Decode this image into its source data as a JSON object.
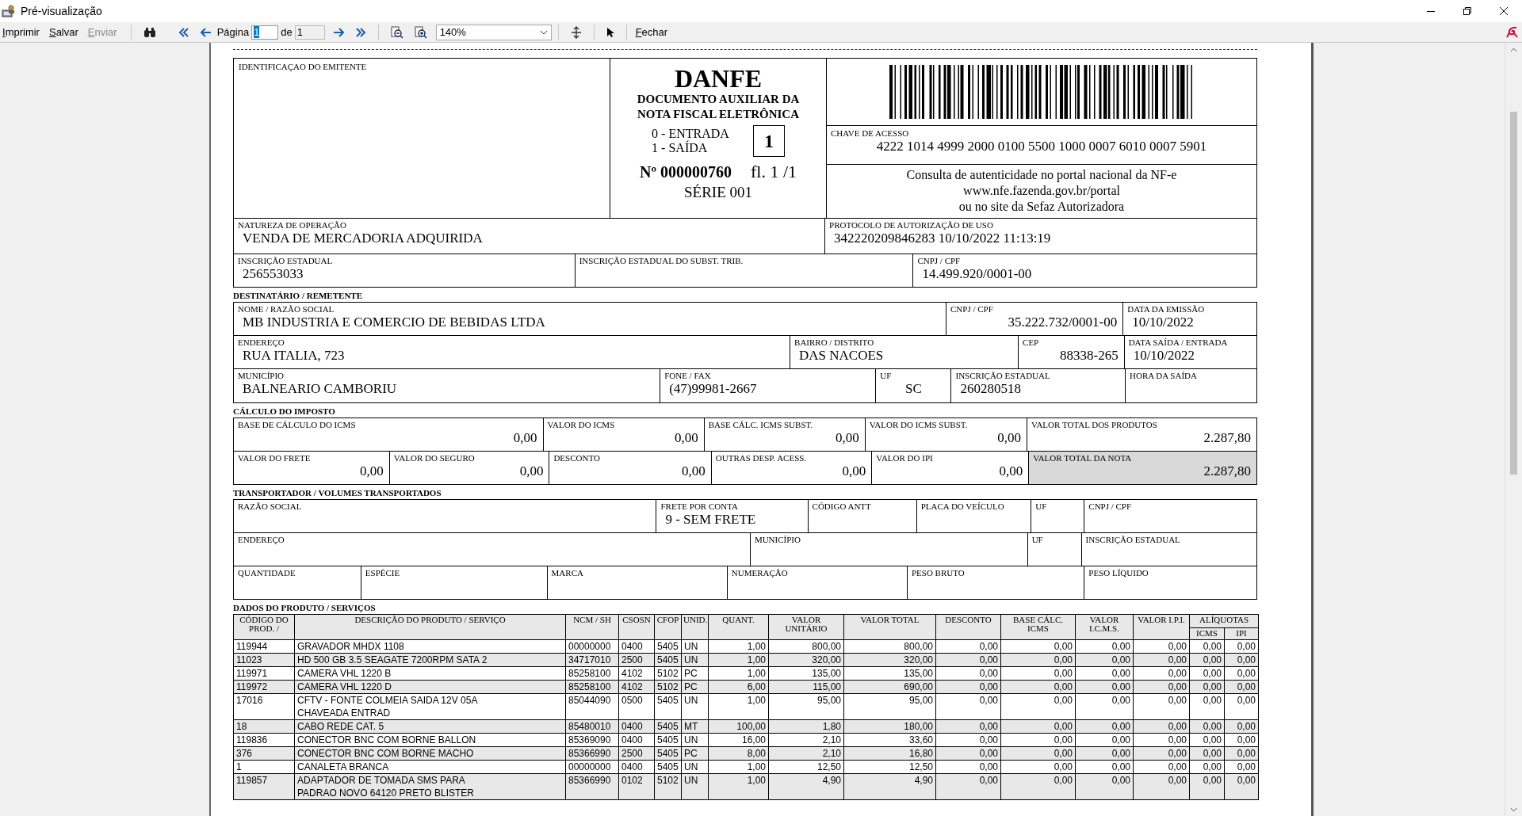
{
  "window": {
    "title": "Pré-visualização"
  },
  "toolbar": {
    "actions": [
      {
        "label": "Imprimir",
        "disabled": false
      },
      {
        "label": "Salvar",
        "disabled": false
      },
      {
        "label": "Enviar",
        "disabled": true
      }
    ],
    "page_label": "Página",
    "page_value": "1",
    "of_label": "de",
    "page_count": "1",
    "zoom": "140%",
    "close": "Fechar"
  },
  "document": {
    "header": {
      "emitter_label": "IDENTIFICAÇAO DO EMITENTE",
      "title": "DANFE",
      "subtitle": [
        "DOCUMENTO AUXILIAR DA",
        "NOTA FISCAL ELETRÔNICA"
      ],
      "operations": [
        "0 - ENTRADA",
        "1 - SAÍDA"
      ],
      "operation_type": "1",
      "number": "Nº 000000760",
      "sheet": "fl. 1 /1",
      "series": "SÉRIE 001",
      "access_key_label": "CHAVE DE ACESSO",
      "access_key": "4222 1014 4999 2000 0100 5500 1000 0007 6010 0007 5901",
      "consult": [
        "Consulta de autenticidade no portal nacional da NF-e",
        "www.nfe.fazenda.gov.br/portal",
        "ou no site da Sefaz Autorizadora"
      ]
    },
    "blocks": [
      {
        "lines": [
          {
            "fields": [
              {
                "label": "NATUREZA DE OPERAÇÃO",
                "value": "VENDA DE MERCADORIA ADQUIRIDA"
              },
              {
                "label": "PROTOCOLO DE AUTORIZAÇÃO DE USO",
                "value": "342220209846283 10/10/2022 11:13:19"
              }
            ]
          },
          {
            "fields": [
              {
                "label": "INSCRIÇÃO ESTADUAL",
                "value": "256553033"
              },
              {
                "label": "INSCRIÇÃO ESTADUAL DO SUBST. TRIB."
              },
              {
                "label": "CNPJ / CPF",
                "value": "14.499.920/0001-00"
              }
            ]
          }
        ]
      },
      {
        "heading": "DESTINATÁRIO / REMETENTE",
        "lines": [
          {
            "fields": [
              {
                "label": "NOME / RAZÃO SOCIAL",
                "value": "MB INDUSTRIA E COMERCIO DE BEBIDAS LTDA"
              },
              {
                "label": "CNPJ / CPF",
                "value": "35.222.732/0001-00"
              },
              {
                "label": "DATA DA EMISSÃO",
                "value": "10/10/2022"
              }
            ]
          },
          {
            "fields": [
              {
                "label": "ENDEREÇO",
                "value": "RUA ITALIA, 723"
              },
              {
                "label": "BAIRRO / DISTRITO",
                "value": "DAS NACOES"
              },
              {
                "label": "CEP",
                "value": "88338-265"
              },
              {
                "label": "DATA SAÍDA / ENTRADA",
                "value": "10/10/2022"
              }
            ]
          },
          {
            "fields": [
              {
                "label": "MUNICÍPIO",
                "value": "BALNEARIO CAMBORIU"
              },
              {
                "label": "FONE / FAX",
                "value": "(47)99981-2667"
              },
              {
                "label": "UF",
                "value": "SC"
              },
              {
                "label": "INSCRIÇÃO ESTADUAL",
                "value": "260280518"
              },
              {
                "label": "HORA DA SAÍDA"
              }
            ]
          }
        ]
      },
      {
        "heading": "CÁLCULO DO IMPOSTO",
        "lines": [
          {
            "fields": [
              {
                "label": "BASE DE CÁLCULO DO ICMS",
                "value": "0,00",
                "highlighted": false
              },
              {
                "label": "VALOR DO ICMS",
                "value": "0,00",
                "highlighted": false
              },
              {
                "label": "BASE CÁLC. ICMS SUBST.",
                "value": "0,00",
                "highlighted": false
              },
              {
                "label": "VALOR DO ICMS SUBST.",
                "value": "0,00",
                "highlighted": false
              },
              {
                "label": "VALOR TOTAL DOS PRODUTOS",
                "value": "2.287,80",
                "highlighted": false
              }
            ]
          },
          {
            "fields": [
              {
                "label": "VALOR DO FRETE",
                "value": "0,00",
                "highlighted": false
              },
              {
                "label": "VALOR DO SEGURO",
                "value": "0,00",
                "highlighted": false
              },
              {
                "label": "DESCONTO",
                "value": "0,00",
                "highlighted": false
              },
              {
                "label": "OUTRAS DESP. ACESS.",
                "value": "0,00",
                "highlighted": false
              },
              {
                "label": "VALOR DO IPI",
                "value": "0,00",
                "highlighted": false
              },
              {
                "label": "VALOR TOTAL DA NOTA",
                "value": "2.287,80",
                "highlighted": true
              }
            ]
          }
        ]
      },
      {
        "heading": "TRANSPORTADOR / VOLUMES TRANSPORTADOS",
        "lines": [
          {
            "fields": [
              {
                "label": "RAZÃO SOCIAL"
              },
              {
                "label": "FRETE POR CONTA",
                "value": "9 - SEM FRETE"
              },
              {
                "label": "CÓDIGO ANTT"
              },
              {
                "label": "PLACA DO VEÍCULO"
              },
              {
                "label": "UF"
              },
              {
                "label": "CNPJ / CPF"
              }
            ]
          },
          {
            "fields": [
              {
                "label": "ENDEREÇO"
              },
              {
                "label": "MUNICÍPIO"
              },
              {
                "label": "UF"
              },
              {
                "label": "INSCRIÇÃO ESTADUAL"
              }
            ]
          },
          {
            "fields": [
              {
                "label": "QUANTIDADE"
              },
              {
                "label": "ESPÉCIE"
              },
              {
                "label": "MARCA"
              },
              {
                "label": "NUMERAÇÃO"
              },
              {
                "label": "PESO BRUTO"
              },
              {
                "label": "PESO LÍQUIDO"
              }
            ]
          }
        ]
      }
    ],
    "products": {
      "heading": "DADOS DO PRODUTO / SERVIÇOS",
      "columns": [
        "CÓDIGO DO PROD. /",
        "DESCRIÇÃO DO PRODUTO / SERVIÇO",
        "NCM / SH",
        "CSOSN",
        "CFOP",
        "UNID.",
        "QUANT.",
        "VALOR UNITÁRIO",
        "VALOR TOTAL",
        "DESCONTO",
        "BASE CÁLC. ICMS",
        "VALOR I.C.M.S.",
        "VALOR I.P.I.",
        "ICMS",
        "IPI"
      ],
      "group_header": "ALÍQUOTAS",
      "rows": [
        [
          "119944",
          "GRAVADOR MHDX 1108",
          "00000000",
          "0400",
          "5405",
          "UN",
          "1,00",
          "800,00",
          "800,00",
          "0,00",
          "0,00",
          "0,00",
          "0,00",
          "0,00",
          "0,00"
        ],
        [
          "11023",
          "HD 500 GB 3.5 SEAGATE 7200RPM SATA 2",
          "34717010",
          "2500",
          "5405",
          "UN",
          "1,00",
          "320,00",
          "320,00",
          "0,00",
          "0,00",
          "0,00",
          "0,00",
          "0,00",
          "0,00"
        ],
        [
          "119971",
          "CAMERA VHL 1220 B",
          "85258100",
          "4102",
          "5102",
          "PC",
          "1,00",
          "135,00",
          "135,00",
          "0,00",
          "0,00",
          "0,00",
          "0,00",
          "0,00",
          "0,00"
        ],
        [
          "119972",
          "CAMERA VHL 1220 D",
          "85258100",
          "4102",
          "5102",
          "PC",
          "6,00",
          "115,00",
          "690,00",
          "0,00",
          "0,00",
          "0,00",
          "0,00",
          "0,00",
          "0,00"
        ],
        [
          "17016",
          "CFTV - FONTE COLMEIA SAIDA 12V 05A\nCHAVEADA ENTRAD",
          "85044090",
          "0500",
          "5405",
          "UN",
          "1,00",
          "95,00",
          "95,00",
          "0,00",
          "0,00",
          "0,00",
          "0,00",
          "0,00",
          "0,00"
        ],
        [
          "18",
          "CABO REDE CAT. 5",
          "85480010",
          "0400",
          "5405",
          "MT",
          "100,00",
          "1,80",
          "180,00",
          "0,00",
          "0,00",
          "0,00",
          "0,00",
          "0,00",
          "0,00"
        ],
        [
          "119836",
          "CONECTOR BNC COM BORNE BALLON",
          "85369090",
          "0400",
          "5405",
          "UN",
          "16,00",
          "2,10",
          "33,60",
          "0,00",
          "0,00",
          "0,00",
          "0,00",
          "0,00",
          "0,00"
        ],
        [
          "376",
          "CONECTOR BNC COM BORNE MACHO",
          "85366990",
          "2500",
          "5405",
          "PC",
          "8,00",
          "2,10",
          "16,80",
          "0,00",
          "0,00",
          "0,00",
          "0,00",
          "0,00",
          "0,00"
        ],
        [
          "1",
          "CANALETA BRANCA",
          "00000000",
          "0400",
          "5405",
          "UN",
          "1,00",
          "12,50",
          "12,50",
          "0,00",
          "0,00",
          "0,00",
          "0,00",
          "0,00",
          "0,00"
        ],
        [
          "119857",
          "ADAPTADOR DE TOMADA SMS PARA\nPADRAO NOVO 64120 PRETO BLISTER",
          "85366990",
          "0102",
          "5102",
          "UN",
          "1,00",
          "4,90",
          "4,90",
          "0,00",
          "0,00",
          "0,00",
          "0,00",
          "0,00",
          "0,00"
        ]
      ]
    }
  }
}
